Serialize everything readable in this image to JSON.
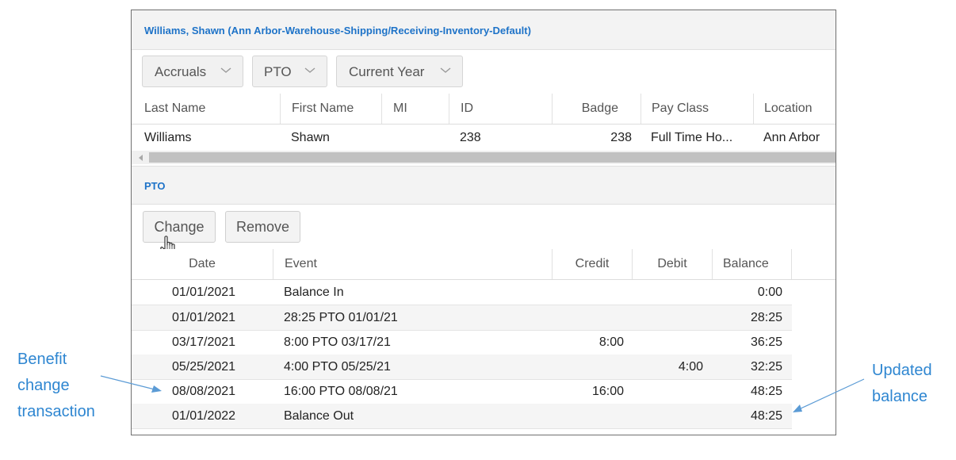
{
  "employee_header": "Williams, Shawn (Ann Arbor-Warehouse-Shipping/Receiving-Inventory-Default)",
  "filters": {
    "accruals": "Accruals",
    "pto": "PTO",
    "year": "Current Year"
  },
  "employee_table": {
    "headers": {
      "last_name": "Last Name",
      "first_name": "First Name",
      "mi": "MI",
      "id": "ID",
      "badge": "Badge",
      "pay_class": "Pay Class",
      "location": "Location"
    },
    "row": {
      "last_name": "Williams",
      "first_name": "Shawn",
      "mi": "",
      "id": "238",
      "badge": "238",
      "pay_class": "Full Time Ho...",
      "location": "Ann Arbor"
    }
  },
  "pto_section": {
    "title": "PTO",
    "change_label": "Change",
    "remove_label": "Remove",
    "headers": {
      "date": "Date",
      "event": "Event",
      "credit": "Credit",
      "debit": "Debit",
      "balance": "Balance"
    },
    "rows": [
      {
        "date": "01/01/2021",
        "event": "Balance In",
        "credit": "",
        "debit": "",
        "balance": "0:00"
      },
      {
        "date": "01/01/2021",
        "event": "28:25 PTO 01/01/21",
        "credit": "",
        "debit": "",
        "balance": "28:25"
      },
      {
        "date": "03/17/2021",
        "event": "8:00 PTO 03/17/21",
        "credit": "8:00",
        "debit": "",
        "balance": "36:25"
      },
      {
        "date": "05/25/2021",
        "event": "4:00 PTO 05/25/21",
        "credit": "",
        "debit": "4:00",
        "balance": "32:25"
      },
      {
        "date": "08/08/2021",
        "event": "16:00 PTO 08/08/21",
        "credit": "16:00",
        "debit": "",
        "balance": "48:25"
      },
      {
        "date": "01/01/2022",
        "event": "Balance Out",
        "credit": "",
        "debit": "",
        "balance": "48:25"
      }
    ]
  },
  "annotations": {
    "left": [
      "Benefit",
      "change",
      "transaction"
    ],
    "right": [
      "Updated",
      "balance"
    ]
  },
  "colors": {
    "accent": "#1e73c8",
    "annotation": "#2e86d1",
    "border": "#6f6f6f"
  }
}
